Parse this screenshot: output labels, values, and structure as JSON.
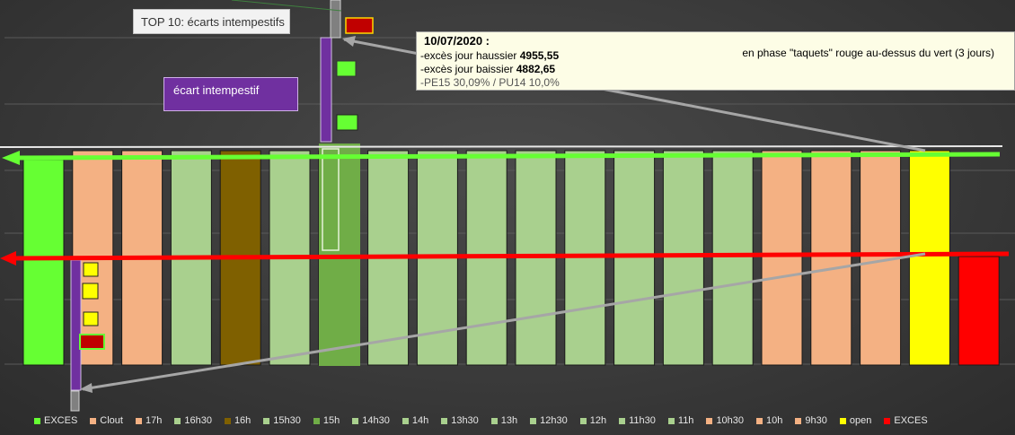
{
  "chart_data": {
    "type": "bar",
    "categories": [
      "EXCES",
      "Clout",
      "17h",
      "16h30",
      "16h",
      "15h30",
      "15h",
      "14h30",
      "14h",
      "13h30",
      "13h",
      "12h30",
      "12h",
      "11h30",
      "11h",
      "10h30",
      "10h",
      "9h30",
      "open",
      "EXCES"
    ],
    "colors": [
      "#66ff33",
      "#f4b183",
      "#f4b183",
      "#a9d08e",
      "#7f6000",
      "#a9d08e",
      "#70ad47",
      "#a9d08e",
      "#a9d08e",
      "#a9d08e",
      "#a9d08e",
      "#a9d08e",
      "#a9d08e",
      "#a9d08e",
      "#a9d08e",
      "#f4b183",
      "#f4b183",
      "#f4b183",
      "#ffff00",
      "#ff0000"
    ],
    "ranges": [
      [
        4882.65,
        4955.55
      ],
      [
        4882.65,
        4955.55
      ],
      [
        4882.65,
        4955.55
      ],
      [
        4882.65,
        4955.55
      ],
      [
        4882.65,
        4955.55
      ],
      [
        4882.65,
        4955.55
      ],
      [
        4882.65,
        4955.55
      ],
      [
        4882.65,
        4955.55
      ],
      [
        4882.65,
        4955.55
      ],
      [
        4882.65,
        4955.55
      ],
      [
        4882.65,
        4955.55
      ],
      [
        4882.65,
        4955.55
      ],
      [
        4882.65,
        4955.55
      ],
      [
        4882.65,
        4955.55
      ],
      [
        4882.65,
        4955.55
      ],
      [
        4882.65,
        4955.55
      ],
      [
        4882.65,
        4955.55
      ],
      [
        4882.65,
        4955.55
      ],
      [
        4882.65,
        4955.55
      ],
      [
        4882.65,
        4955.55
      ]
    ],
    "legend_position": "bottom",
    "grid": true
  },
  "annotations": {
    "title_box": "TOP 10: écarts intempestifs",
    "purple_label": "écart intempestif",
    "note": {
      "date": "10/07/2020 :",
      "phase": "en phase \"taquets\" rouge au-dessus du vert (3 jours)",
      "line1_label": "-excès jour haussier",
      "line1_value": "4955,55",
      "line2_label": "-excès jour baissier",
      "line2_value": "4882,65",
      "line3": "-PE15 30,09% / PU14 10,0%"
    }
  }
}
